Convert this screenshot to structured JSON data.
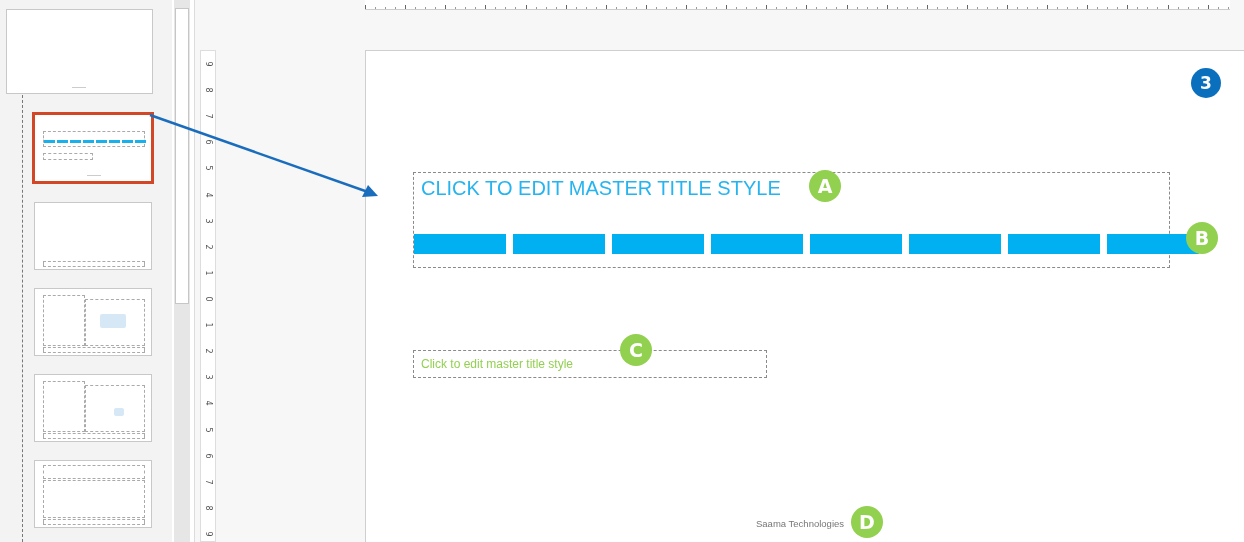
{
  "thumbnails": [
    {
      "kind": "master",
      "selected": false
    },
    {
      "kind": "title-bars",
      "selected": true
    },
    {
      "kind": "footer-only",
      "selected": false
    },
    {
      "kind": "two-content",
      "selected": false
    },
    {
      "kind": "picture-content",
      "selected": false
    },
    {
      "kind": "vertical",
      "selected": false
    }
  ],
  "vertical_ruler": [
    "9",
    "8",
    "7",
    "6",
    "5",
    "4",
    "3",
    "2",
    "1",
    "0",
    "1",
    "2",
    "3",
    "4",
    "5",
    "6",
    "7",
    "8",
    "9"
  ],
  "slide": {
    "number_badge": "3",
    "title": "CLICK TO EDIT MASTER TITLE STYLE",
    "subtitle": "Click to edit master title style",
    "footer": "Saama Technologies",
    "callouts": [
      {
        "label": "A"
      },
      {
        "label": "B"
      },
      {
        "label": "C"
      },
      {
        "label": "D"
      }
    ]
  }
}
